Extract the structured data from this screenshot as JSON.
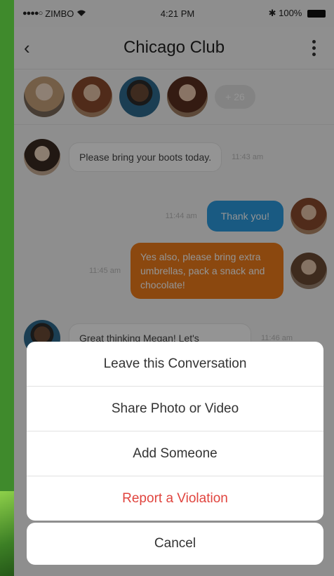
{
  "status_bar": {
    "carrier": "ZIMBO",
    "time": "4:21 PM",
    "battery": "100%"
  },
  "header": {
    "title": "Chicago Club"
  },
  "members": {
    "extra_count": "+ 26"
  },
  "messages": [
    {
      "text": "Please bring your boots today.",
      "time": "11:43 am"
    },
    {
      "text": "Thank you!",
      "time": "11:44 am"
    },
    {
      "text": "Yes also, please bring extra umbrellas, pack a snack and chocolate!",
      "time": "11:45 am"
    },
    {
      "text": "Great thinking Megan! Let's",
      "time": "11:46 am"
    }
  ],
  "action_sheet": {
    "items": [
      {
        "label": "Leave this Conversation"
      },
      {
        "label": "Share Photo or Video"
      },
      {
        "label": "Add Someone"
      },
      {
        "label": "Report a Violation"
      }
    ],
    "cancel_label": "Cancel"
  },
  "colors": {
    "accent_blue": "#2c9ce0",
    "accent_orange": "#f07c1a",
    "danger_red": "#e0443e"
  }
}
